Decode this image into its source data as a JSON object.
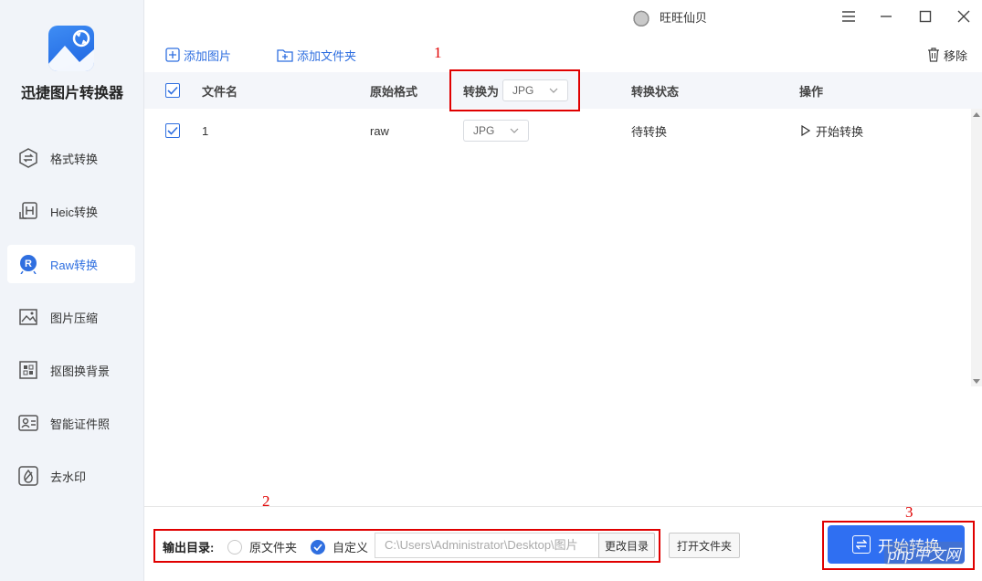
{
  "app": {
    "title": "迅捷图片转换器"
  },
  "user": {
    "name": "旺旺仙贝"
  },
  "sidebar": {
    "items": [
      {
        "label": "格式转换",
        "icon": "format-convert-icon"
      },
      {
        "label": "Heic转换",
        "icon": "heic-icon"
      },
      {
        "label": "Raw转换",
        "icon": "raw-icon",
        "active": true
      },
      {
        "label": "图片压缩",
        "icon": "image-compress-icon"
      },
      {
        "label": "抠图换背景",
        "icon": "cutout-icon"
      },
      {
        "label": "智能证件照",
        "icon": "id-photo-icon"
      },
      {
        "label": "去水印",
        "icon": "watermark-remove-icon"
      }
    ]
  },
  "toolbar": {
    "add_image": "添加图片",
    "add_folder": "添加文件夹",
    "remove": "移除"
  },
  "table": {
    "headers": {
      "filename": "文件名",
      "original_format": "原始格式",
      "convert_to": "转换为",
      "convert_to_value": "JPG",
      "status": "转换状态",
      "action": "操作"
    },
    "rows": [
      {
        "checked": true,
        "filename": "1",
        "original_format": "raw",
        "target_format": "JPG",
        "status": "待转换",
        "action": "开始转换"
      }
    ]
  },
  "footer": {
    "output_label": "输出目录:",
    "option_original": "原文件夹",
    "option_custom": "自定义",
    "path": "C:\\Users\\Administrator\\Desktop\\图片",
    "change_dir": "更改目录",
    "open_folder": "打开文件夹",
    "start_button": "开始转换"
  },
  "annotations": {
    "n1": "1",
    "n2": "2",
    "n3": "3"
  },
  "watermark": "php中文网",
  "colors": {
    "accent": "#2f6ff2",
    "annotation": "#e00000",
    "sidebar_bg": "#f1f4f9"
  }
}
